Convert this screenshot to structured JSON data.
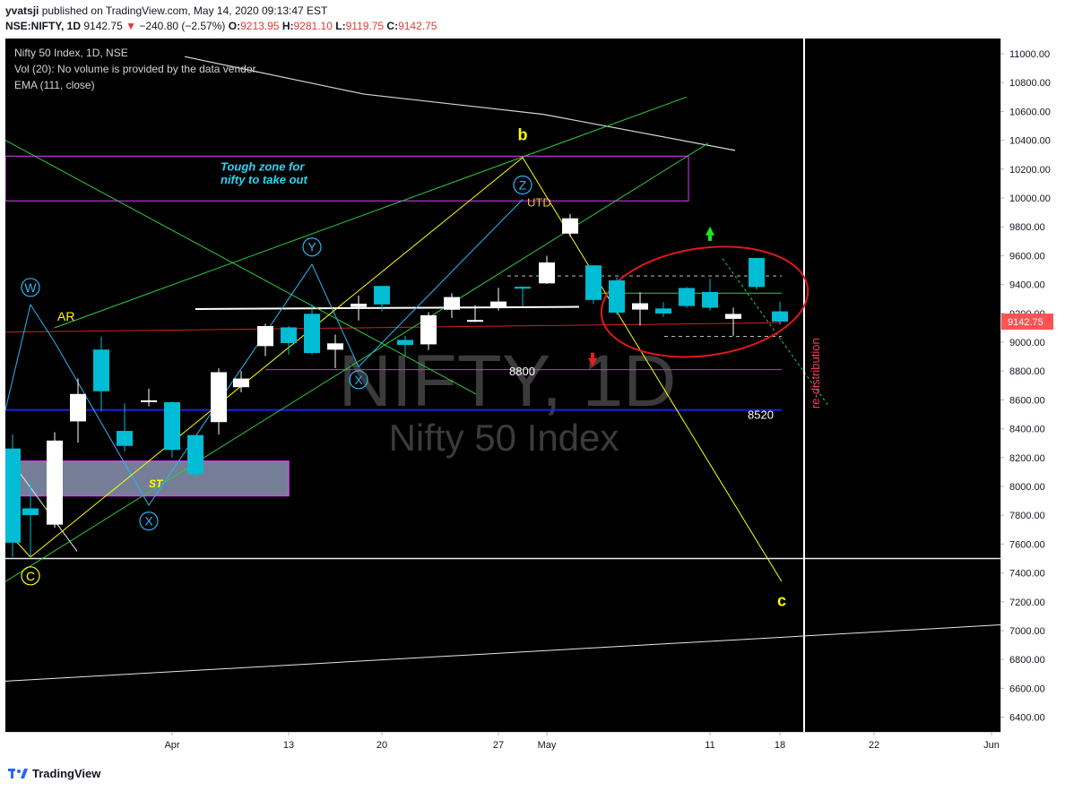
{
  "header": {
    "publisher": "yvatsji",
    "published_text": "published on TradingView.com, May 14, 2020 09:13:47 EST",
    "symbol": "NSE:NIFTY, 1D",
    "last": "9142.75",
    "change_arrow": "▼",
    "change": "−240.80 (−2.57%)",
    "open_label": "O:",
    "open": "9213.95",
    "high_label": "H:",
    "high": "9281.10",
    "low_label": "L:",
    "low": "9119.75",
    "close_label": "C:",
    "close": "9142.75"
  },
  "legend": {
    "title": "Nifty 50 Index, 1D, NSE",
    "volume": "Vol (20): No volume is provided by the data vendor.",
    "ema": "EMA (111, close)"
  },
  "watermark": {
    "big": "NIFTY, 1D",
    "small": "Nifty 50 Index"
  },
  "colors": {
    "background": "#000000",
    "up_candle": "#ffffff",
    "down_candle": "#00bcd4",
    "fib_yellow": "#ffff00",
    "green_line": "#2ecc40",
    "zone_border": "#e040fb",
    "support_blue": "#1e1ee6",
    "ellipse_red": "#e01818",
    "redistribution": "#ff3b5c",
    "price_badge": "#ff5252"
  },
  "footer": {
    "brand": "TradingView",
    "logo_icon": "tradingview-logo-icon"
  },
  "chart_data": {
    "type": "candlestick",
    "ylim": [
      6300,
      11200
    ],
    "price_ticks": [
      "11000.00",
      "10800.00",
      "10600.00",
      "10400.00",
      "10200.00",
      "10000.00",
      "9800.00",
      "9600.00",
      "9400.00",
      "9200.00",
      "9000.00",
      "8800.00",
      "8600.00",
      "8400.00",
      "8200.00",
      "8000.00",
      "7800.00",
      "7600.00",
      "7400.00",
      "7200.00",
      "7000.00",
      "6800.00",
      "6600.00",
      "6400.00"
    ],
    "last_price_label": "9142.75",
    "x_ticks": [
      {
        "label": "Apr",
        "date": "2020-04-01"
      },
      {
        "label": "13",
        "date": "2020-04-13"
      },
      {
        "label": "20",
        "date": "2020-04-20"
      },
      {
        "label": "27",
        "date": "2020-04-27"
      },
      {
        "label": "May",
        "date": "2020-05-01"
      },
      {
        "label": "11",
        "date": "2020-05-11"
      },
      {
        "label": "18",
        "date": "2020-05-18"
      },
      {
        "label": "22",
        "date": "2020-05-22"
      },
      {
        "label": "Jun",
        "date": "2020-06-01"
      }
    ],
    "candles": [
      {
        "date": "2020-03-23",
        "o": 8263,
        "h": 8360,
        "l": 7511,
        "c": 7610
      },
      {
        "date": "2020-03-24",
        "o": 7848,
        "h": 8036,
        "l": 7511,
        "c": 7801
      },
      {
        "date": "2020-03-25",
        "o": 7735,
        "h": 8376,
        "l": 7714,
        "c": 8318
      },
      {
        "date": "2020-03-26",
        "o": 8451,
        "h": 8749,
        "l": 8304,
        "c": 8641
      },
      {
        "date": "2020-03-27",
        "o": 8949,
        "h": 9039,
        "l": 8522,
        "c": 8660
      },
      {
        "date": "2020-03-30",
        "o": 8385,
        "h": 8576,
        "l": 8244,
        "c": 8281
      },
      {
        "date": "2020-03-31",
        "o": 8584,
        "h": 8678,
        "l": 8555,
        "c": 8597
      },
      {
        "date": "2020-04-01",
        "o": 8584,
        "h": 8588,
        "l": 8198,
        "c": 8253
      },
      {
        "date": "2020-04-03",
        "o": 8356,
        "h": 8356,
        "l": 8056,
        "c": 8084
      },
      {
        "date": "2020-04-07",
        "o": 8446,
        "h": 8819,
        "l": 8360,
        "c": 8792
      },
      {
        "date": "2020-04-08",
        "o": 8688,
        "h": 8800,
        "l": 8653,
        "c": 8748
      },
      {
        "date": "2020-04-09",
        "o": 8973,
        "h": 9128,
        "l": 8904,
        "c": 9112
      },
      {
        "date": "2020-04-13",
        "o": 9103,
        "h": 9112,
        "l": 8913,
        "c": 8994
      },
      {
        "date": "2020-04-15",
        "o": 9197,
        "h": 9262,
        "l": 8915,
        "c": 8925
      },
      {
        "date": "2020-04-16",
        "o": 8948,
        "h": 9053,
        "l": 8821,
        "c": 8992
      },
      {
        "date": "2020-04-17",
        "o": 9244,
        "h": 9324,
        "l": 9151,
        "c": 9267
      },
      {
        "date": "2020-04-20",
        "o": 9390,
        "h": 9391,
        "l": 9213,
        "c": 9262
      },
      {
        "date": "2020-04-21",
        "o": 9016,
        "h": 9044,
        "l": 8910,
        "c": 8981
      },
      {
        "date": "2020-04-22",
        "o": 8985,
        "h": 9208,
        "l": 8946,
        "c": 9187
      },
      {
        "date": "2020-04-23",
        "o": 9225,
        "h": 9339,
        "l": 9168,
        "c": 9313
      },
      {
        "date": "2020-04-24",
        "o": 9142,
        "h": 9256,
        "l": 9140,
        "c": 9154
      },
      {
        "date": "2020-04-27",
        "o": 9239,
        "h": 9377,
        "l": 9220,
        "c": 9282
      },
      {
        "date": "2020-04-28",
        "o": 9384,
        "h": 9389,
        "l": 9249,
        "c": 9380
      },
      {
        "date": "2020-04-29",
        "o": 9408,
        "h": 9599,
        "l": 9404,
        "c": 9553
      },
      {
        "date": "2020-04-30",
        "o": 9753,
        "h": 9889,
        "l": 9731,
        "c": 9859
      },
      {
        "date": "2020-05-04",
        "o": 9533,
        "h": 9533,
        "l": 9266,
        "c": 9293
      },
      {
        "date": "2020-05-05",
        "o": 9429,
        "h": 9450,
        "l": 9190,
        "c": 9205
      },
      {
        "date": "2020-05-06",
        "o": 9226,
        "h": 9346,
        "l": 9116,
        "c": 9270
      },
      {
        "date": "2020-05-07",
        "o": 9234,
        "h": 9277,
        "l": 9175,
        "c": 9199
      },
      {
        "date": "2020-05-08",
        "o": 9376,
        "h": 9382,
        "l": 9238,
        "c": 9251
      },
      {
        "date": "2020-05-11",
        "o": 9348,
        "h": 9440,
        "l": 9219,
        "c": 9239
      },
      {
        "date": "2020-05-12",
        "o": 9162,
        "h": 9240,
        "l": 9044,
        "c": 9196
      },
      {
        "date": "2020-05-13",
        "o": 9584,
        "h": 9584,
        "l": 9365,
        "c": 9383
      },
      {
        "date": "2020-05-14",
        "o": 9214,
        "h": 9281,
        "l": 9120,
        "c": 9143
      }
    ],
    "annotations": {
      "wave_labels": [
        "W",
        "X",
        "Y",
        "X",
        "Z"
      ],
      "fib_labels": [
        "C",
        "b",
        "c"
      ],
      "text_labels": [
        "AR",
        "ST",
        "UTD",
        "8800",
        "8520",
        "re-distribution"
      ],
      "zone_note": [
        "Tough zone for",
        "nifty to take out"
      ]
    }
  }
}
